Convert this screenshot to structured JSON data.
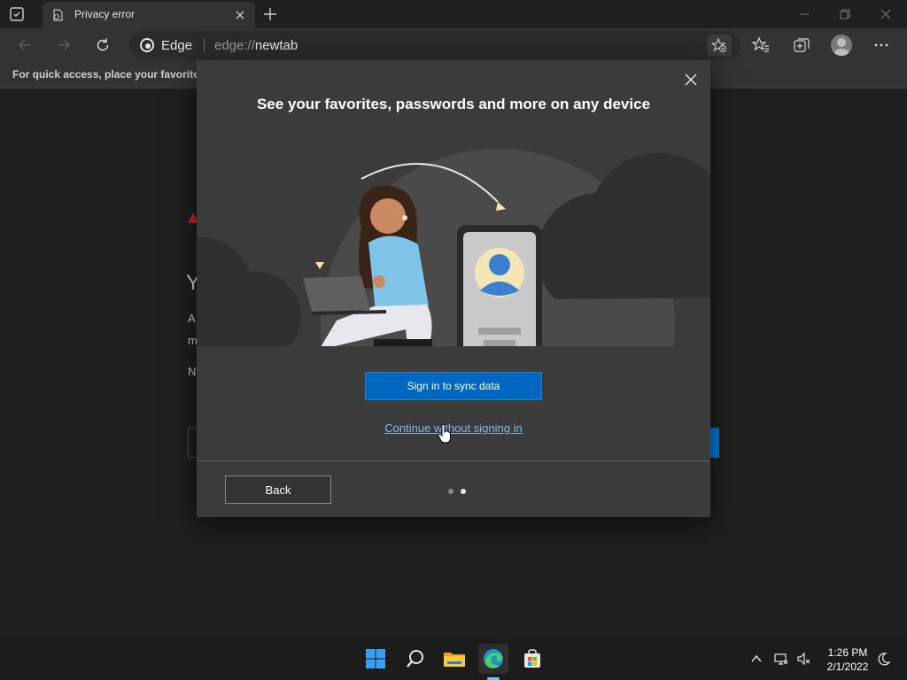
{
  "browser": {
    "tab_title": "Privacy error",
    "site_label": "Edge",
    "url_scheme": "edge://",
    "url_host": "newtab",
    "favorites_bar_text": "For quick access, place your favorites h"
  },
  "background_page": {
    "title_glimpse": "Y",
    "line_1": "A",
    "line_2": "m",
    "line_3": "N"
  },
  "dialog": {
    "title": "See your favorites, passwords and more on any device",
    "primary_button": "Sign in to sync data",
    "secondary_link": "Continue without signing in",
    "back_button": "Back",
    "pager": {
      "total": 2,
      "current": 2
    }
  },
  "taskbar": {
    "apps": [
      "start-icon",
      "search-icon",
      "file-explorer-icon",
      "edge-icon",
      "store-icon"
    ],
    "active_app": "edge-icon",
    "time": "1:26 PM",
    "date": "2/1/2022"
  },
  "colors": {
    "accent": "#0067c0",
    "link": "#80b8ec",
    "warning": "#c42b1c",
    "dialog_bg": "#3b3b3b",
    "page_bg": "#1f1f1f"
  }
}
